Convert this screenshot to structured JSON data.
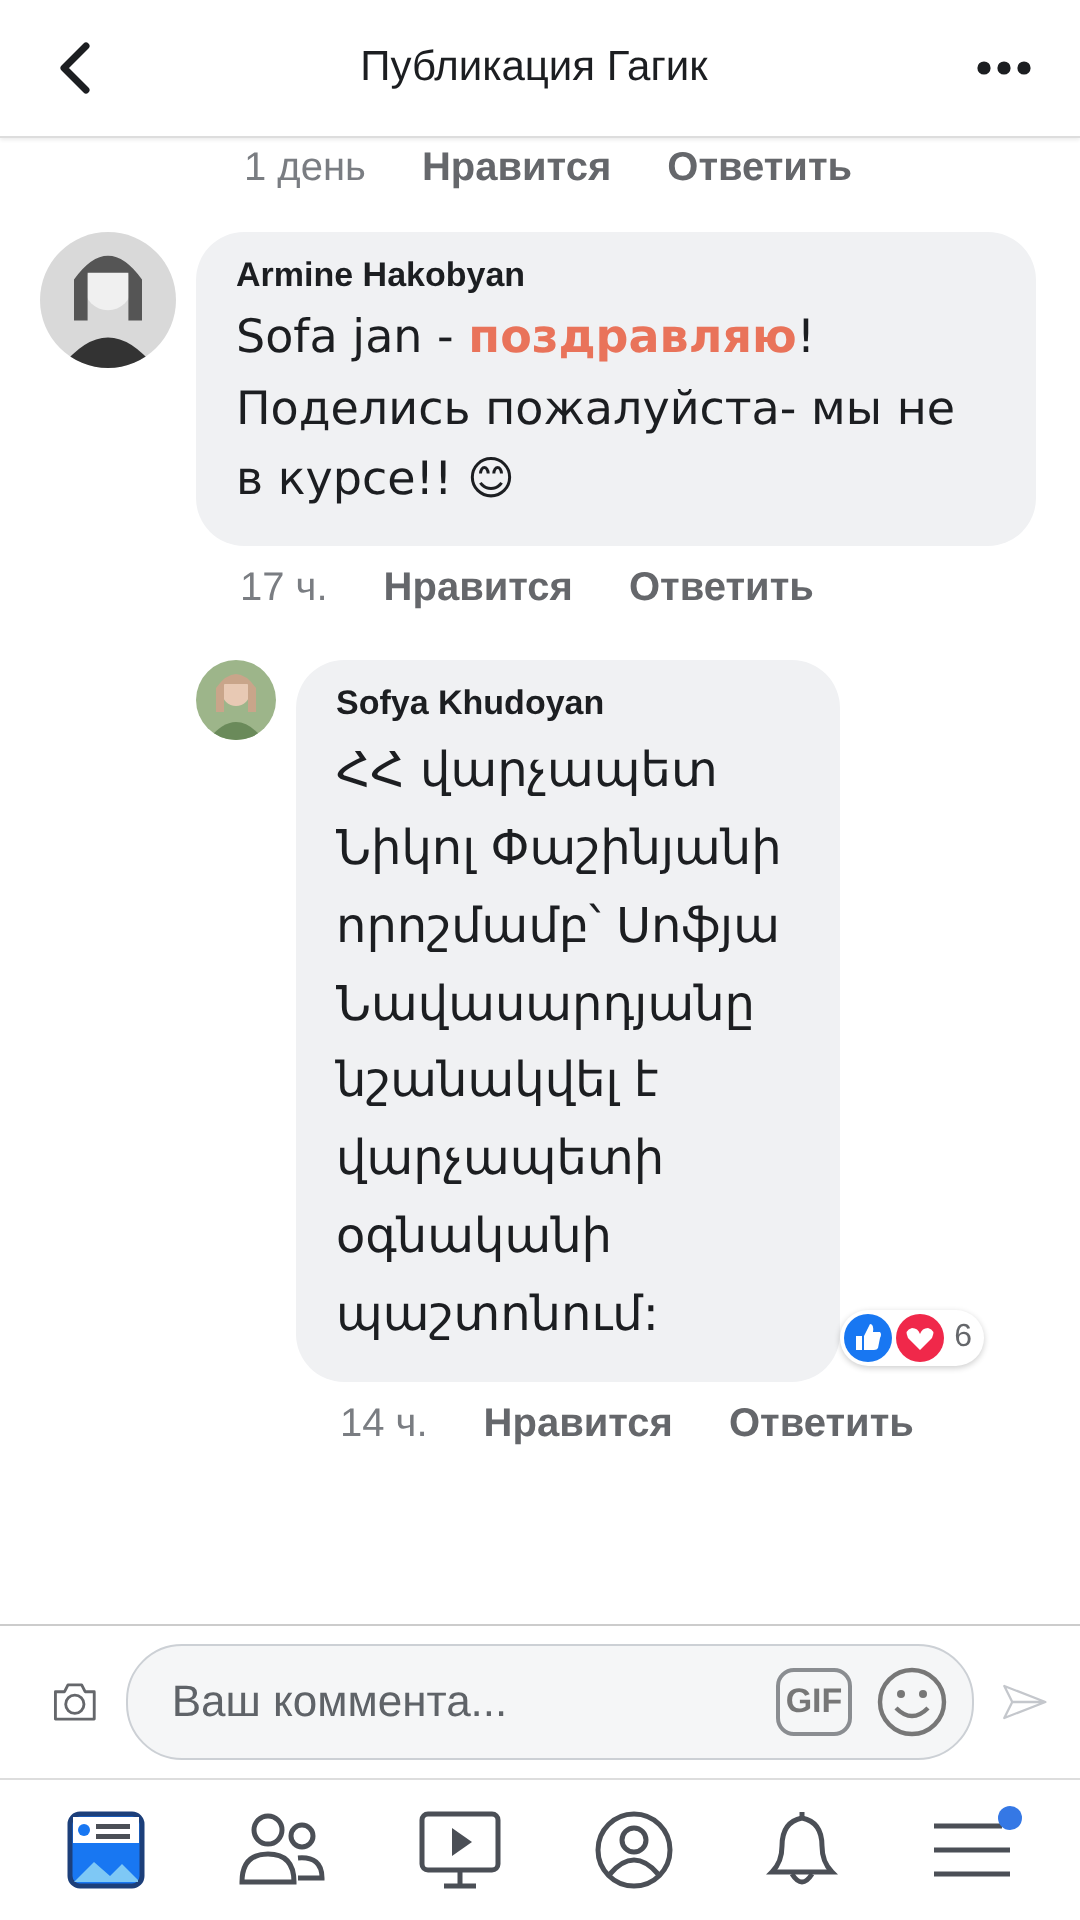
{
  "header": {
    "title": "Публикация Гагик"
  },
  "partial_meta": {
    "time": "1 день",
    "like": "Нравится",
    "reply": "Ответить"
  },
  "comments": [
    {
      "author": "Armine Hakobyan",
      "text": "Sofa jan - **поздравляю**! Поделись пожалуйста- мы не в курсе!! 😊",
      "time": "17 ч.",
      "like": "Нравится",
      "reply": "Ответить",
      "is_reply": false
    },
    {
      "author": "Sofya Khudoyan",
      "text": "ՀՀ վարչապետ Նիկոլ Փաշինյանի որոշմամբ՝ Սոֆյա Նավասարդյանը նշանակվել է վարչապետի օգնականի պաշտոնում:",
      "time": "14 ч.",
      "like": "Нравится",
      "reply": "Ответить",
      "is_reply": true,
      "reactions": {
        "count": "6"
      }
    }
  ],
  "composer": {
    "placeholder": "Ваш коммента...",
    "gif": "GIF"
  },
  "tabs": [
    {
      "kind": "feed",
      "selected": true
    },
    {
      "kind": "friends",
      "selected": false
    },
    {
      "kind": "watch",
      "selected": false
    },
    {
      "kind": "profile",
      "selected": false
    },
    {
      "kind": "notifications",
      "selected": false
    },
    {
      "kind": "menu",
      "selected": false,
      "badge": true
    }
  ]
}
